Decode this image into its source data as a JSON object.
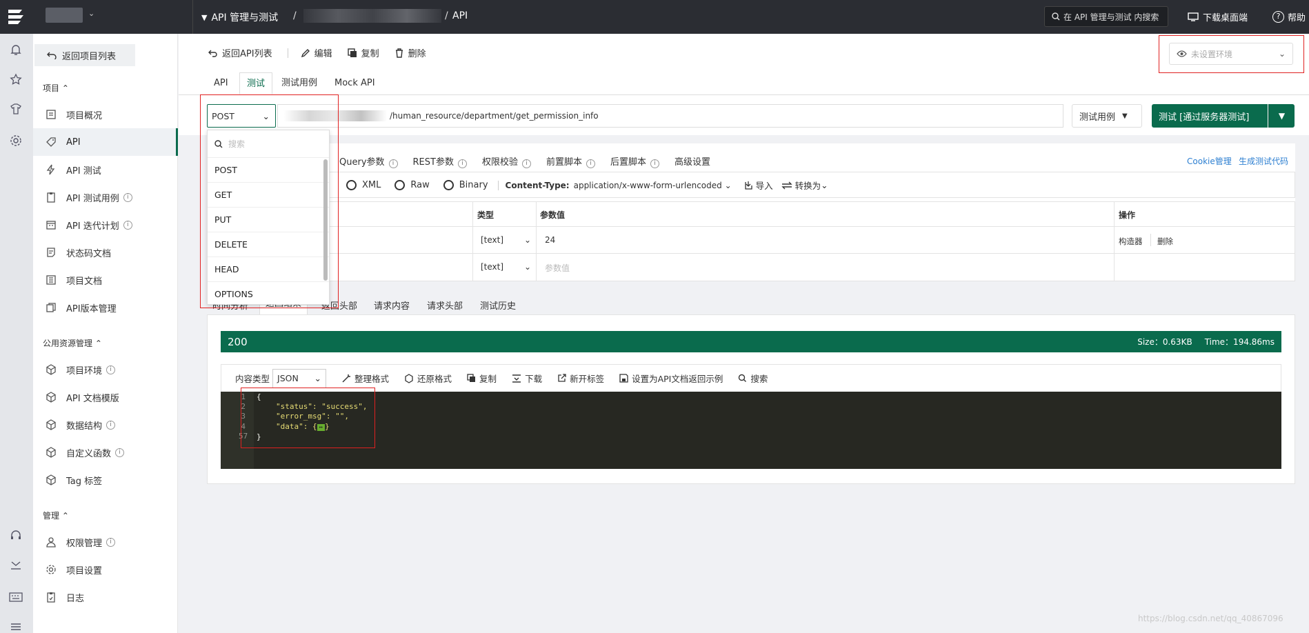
{
  "topbar": {
    "module": "API 管理与测试",
    "breadcrumb_sep1": "/",
    "breadcrumb_sep2": "/",
    "breadcrumb_last": "API",
    "search_placeholder": "在 API 管理与测试 内搜索",
    "download_label": "下载桌面端",
    "help_label": "帮助"
  },
  "sidebar": {
    "back_label": "返回项目列表",
    "section_project": "项目",
    "section_common": "公用资源管理",
    "section_manage": "管理",
    "items": [
      {
        "label": "项目概况"
      },
      {
        "label": "API"
      },
      {
        "label": "API 测试"
      },
      {
        "label": "API 测试用例"
      },
      {
        "label": "API 迭代计划"
      },
      {
        "label": "状态码文档"
      },
      {
        "label": "项目文档"
      },
      {
        "label": "API版本管理"
      }
    ],
    "common_items": [
      {
        "label": "项目环境"
      },
      {
        "label": "API 文档模版"
      },
      {
        "label": "数据结构"
      },
      {
        "label": "自定义函数"
      },
      {
        "label": "Tag 标签"
      }
    ],
    "manage_items": [
      {
        "label": "权限管理"
      },
      {
        "label": "项目设置"
      },
      {
        "label": "日志"
      }
    ]
  },
  "toolbar": {
    "back_api_list": "返回API列表",
    "edit": "编辑",
    "copy": "复制",
    "delete": "删除",
    "env_placeholder": "未设置环境"
  },
  "tabs": [
    "API",
    "测试",
    "测试用例",
    "Mock API"
  ],
  "request": {
    "method": "POST",
    "url": "/human_resource/department/get_permission_info",
    "test_case_btn": "测试用例",
    "send_btn": "测试 [通过服务器测试]"
  },
  "method_dropdown": {
    "search_placeholder": "搜索",
    "options": [
      "POST",
      "GET",
      "PUT",
      "DELETE",
      "HEAD",
      "OPTIONS"
    ]
  },
  "param_tabs": [
    "Query参数",
    "REST参数",
    "权限校验",
    "前置脚本",
    "后置脚本",
    "高级设置"
  ],
  "param_links": {
    "cookie": "Cookie管理",
    "gen_code": "生成测试代码"
  },
  "body_types": {
    "xml": "XML",
    "raw": "Raw",
    "binary": "Binary",
    "content_type_label": "Content-Type:",
    "content_type_value": "application/x-www-form-urlencoded",
    "import": "导入",
    "convert": "转换为"
  },
  "param_table": {
    "headers": [
      "类型",
      "参数值",
      "操作"
    ],
    "rows": [
      {
        "type": "[text]",
        "value": "24",
        "placeholder": "",
        "actions": [
          "构造器",
          "删除"
        ]
      },
      {
        "type": "[text]",
        "value": "",
        "placeholder": "参数值",
        "actions": []
      }
    ]
  },
  "result_tabs": [
    "时间分析",
    "返回结果",
    "返回头部",
    "请求内容",
    "请求头部",
    "测试历史"
  ],
  "result": {
    "status": "200",
    "size": "Size：0.63KB",
    "time": "Time：194.86ms",
    "content_type_label": "内容类型",
    "content_type_value": "JSON",
    "actions": [
      "整理格式",
      "还原格式",
      "复制",
      "下载",
      "新开标签",
      "设置为API文档返回示例",
      "搜索"
    ]
  },
  "code": {
    "line_numbers": [
      "1",
      "2",
      "3",
      "4",
      "57"
    ],
    "lines": [
      "{",
      "\"status\": \"success\",",
      "\"error_msg\": \"\",",
      "\"data\": {",
      "}"
    ],
    "fold_marker": "↔"
  },
  "watermark": "https://blog.csdn.net/qq_40867096",
  "colors": {
    "brand": "#0a6b4d",
    "topbar": "#2b2d33",
    "highlight": "#e02020"
  }
}
